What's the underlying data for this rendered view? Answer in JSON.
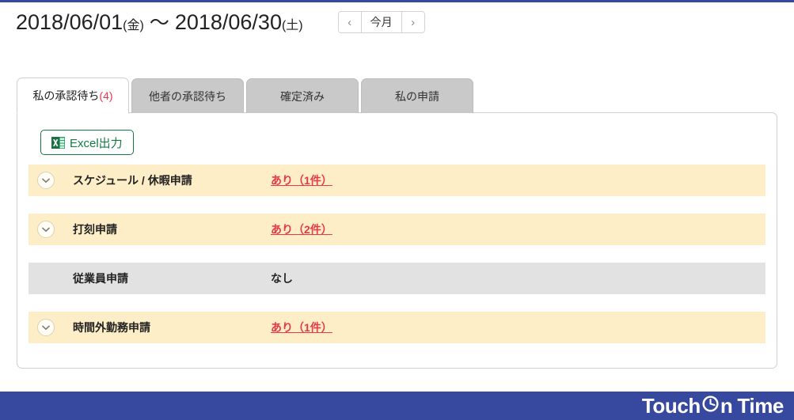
{
  "header": {
    "date_start": "2018/06/01",
    "date_start_dow": "(金)",
    "separator": "〜",
    "date_end": "2018/06/30",
    "date_end_dow": "(土)",
    "nav": {
      "prev_label": "‹",
      "current_label": "今月",
      "next_label": "›"
    }
  },
  "tabs": [
    {
      "label": "私の承認待ち",
      "count": "(4)",
      "active": true
    },
    {
      "label": "他者の承認待ち",
      "count": "",
      "active": false
    },
    {
      "label": "確定済み",
      "count": "",
      "active": false
    },
    {
      "label": "私の申請",
      "count": "",
      "active": false
    }
  ],
  "toolbar": {
    "excel_label": "Excel出力"
  },
  "rows": [
    {
      "label": "スケジュール / 休暇申請",
      "value": "あり（1件）",
      "has_items": true,
      "expandable": true
    },
    {
      "label": "打刻申請",
      "value": "あり（2件）",
      "has_items": true,
      "expandable": true
    },
    {
      "label": "従業員申請",
      "value": "なし",
      "has_items": false,
      "expandable": false
    },
    {
      "label": "時間外勤務申請",
      "value": "あり（1件）",
      "has_items": true,
      "expandable": true
    }
  ],
  "footer": {
    "brand_part1": "Touch",
    "brand_part2": "n",
    "brand_part3": "Time"
  },
  "colors": {
    "accent_blue": "#37499e",
    "link_red": "#e8384a",
    "excel_green": "#147a43",
    "row_highlight": "#fdeec7",
    "row_muted": "#e2e2e2",
    "tab_inactive": "#c9c9c9"
  }
}
